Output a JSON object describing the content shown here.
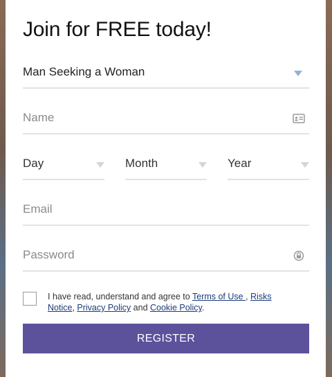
{
  "form": {
    "title": "Join for FREE today!",
    "seeking": {
      "value": "Man Seeking a Woman"
    },
    "name": {
      "placeholder": "Name"
    },
    "birth": {
      "day": "Day",
      "month": "Month",
      "year": "Year"
    },
    "email": {
      "placeholder": "Email"
    },
    "password": {
      "placeholder": "Password"
    },
    "agreement": {
      "text_before": "I have read, understand and agree to ",
      "terms_link": "Terms of Use ",
      "sep1": ", ",
      "risks_link": "Risks Notice",
      "sep2": ", ",
      "privacy_link": "Privacy Policy",
      "and": " and ",
      "cookie_link": "Cookie Policy",
      "end": "."
    },
    "register_label": "REGISTER"
  },
  "colors": {
    "button": "#5b529b",
    "link": "#1a3a7a",
    "caret": "#8fb2d6"
  },
  "icons": {
    "name": "id-card-icon",
    "password": "lock-eye-icon"
  }
}
